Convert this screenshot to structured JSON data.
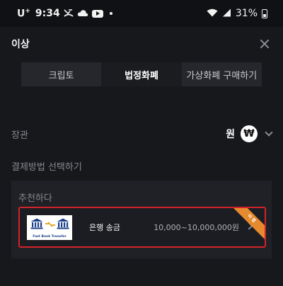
{
  "status_bar": {
    "carrier": "U",
    "carrier_sup": "+",
    "time": "9:34",
    "battery": "31%",
    "icons": [
      "missed-call-icon",
      "cloud-icon",
      "youtube-icon",
      "dot-icon",
      "wifi-icon",
      "signal-icon",
      "battery-icon"
    ]
  },
  "header": {
    "title": "이상"
  },
  "tabs": [
    {
      "label": "크립토",
      "active": false
    },
    {
      "label": "법정화폐",
      "active": true
    },
    {
      "label": "가상화폐 구매하기",
      "active": false
    }
  ],
  "currency_row": {
    "label": "장관",
    "currency": "원",
    "currency_symbol": "₩"
  },
  "payment": {
    "label": "결제방법 선택하기",
    "recommend_title": "추천하다",
    "option": {
      "name": "은행 송금",
      "range": "10,000~10,000,000원",
      "logo_text": "Fast Bank Transfer",
      "badge": "이 앱"
    }
  },
  "colors": {
    "background": "#17181c",
    "highlight_border": "#d1232a",
    "badge": "#e58a2e"
  }
}
